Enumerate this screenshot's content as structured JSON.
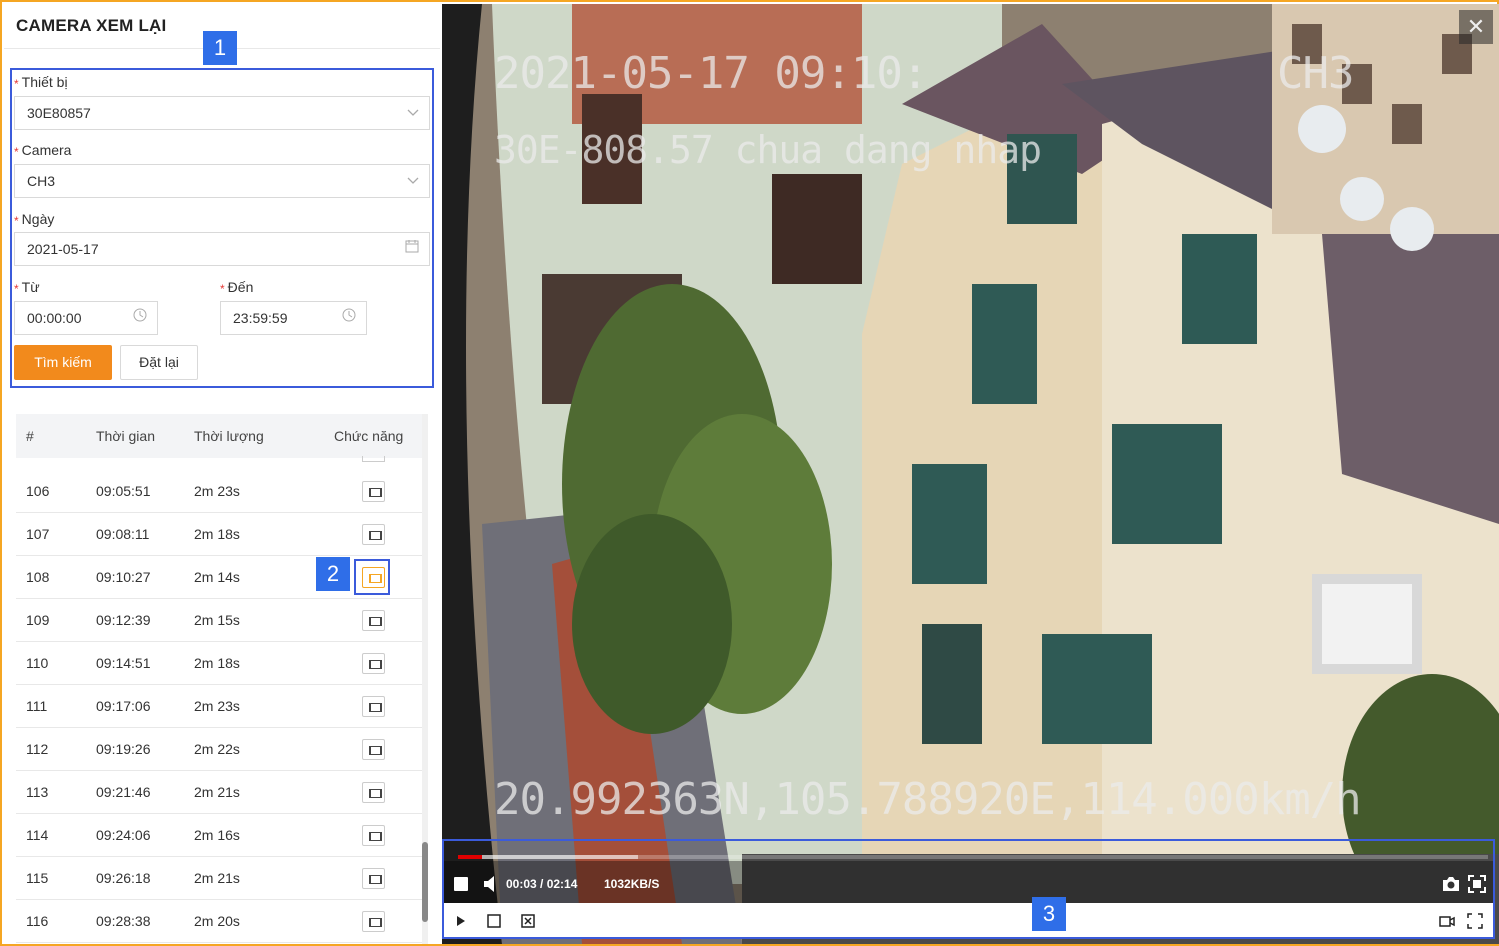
{
  "panel": {
    "title": "CAMERA XEM LẠI",
    "device_label": "Thiết bị",
    "device_value": "30E80857",
    "camera_label": "Camera",
    "camera_value": "CH3",
    "date_label": "Ngày",
    "date_value": "2021-05-17",
    "from_label": "Từ",
    "from_value": "00:00:00",
    "to_label": "Đến",
    "to_value": "23:59:59",
    "search_button": "Tìm kiếm",
    "reset_button": "Đặt lại",
    "required_mark": "*"
  },
  "table": {
    "headers": [
      "#",
      "Thời gian",
      "Thời lượng",
      "Chức năng"
    ],
    "rows": [
      {
        "id": "106",
        "time": "09:05:51",
        "duration": "2m 23s"
      },
      {
        "id": "107",
        "time": "09:08:11",
        "duration": "2m 18s"
      },
      {
        "id": "108",
        "time": "09:10:27",
        "duration": "2m 14s"
      },
      {
        "id": "109",
        "time": "09:12:39",
        "duration": "2m 15s"
      },
      {
        "id": "110",
        "time": "09:14:51",
        "duration": "2m 18s"
      },
      {
        "id": "111",
        "time": "09:17:06",
        "duration": "2m 23s"
      },
      {
        "id": "112",
        "time": "09:19:26",
        "duration": "2m 22s"
      },
      {
        "id": "113",
        "time": "09:21:46",
        "duration": "2m 21s"
      },
      {
        "id": "114",
        "time": "09:24:06",
        "duration": "2m 16s"
      },
      {
        "id": "115",
        "time": "09:26:18",
        "duration": "2m 21s"
      },
      {
        "id": "116",
        "time": "09:28:38",
        "duration": "2m 20s"
      }
    ],
    "active_row": "108"
  },
  "badges": {
    "one": "1",
    "two": "2",
    "three": "3"
  },
  "video": {
    "osd_datetime": "2021-05-17 09:10:",
    "osd_channel": "CH3",
    "osd_plate": "30E-808.57 chua dang nhap",
    "osd_gps": "20.992363N,105.788920E,114.000km/h",
    "close_label": "✕",
    "time_display": "00:03 / 02:14",
    "bitrate": "1032KB/S",
    "progress": 0.017,
    "accent_color": "#e00000"
  },
  "colors": {
    "primary": "#f28a1c",
    "annotation": "#3b5bdb",
    "badge": "#2f6ee8",
    "border": "#f5a623"
  }
}
